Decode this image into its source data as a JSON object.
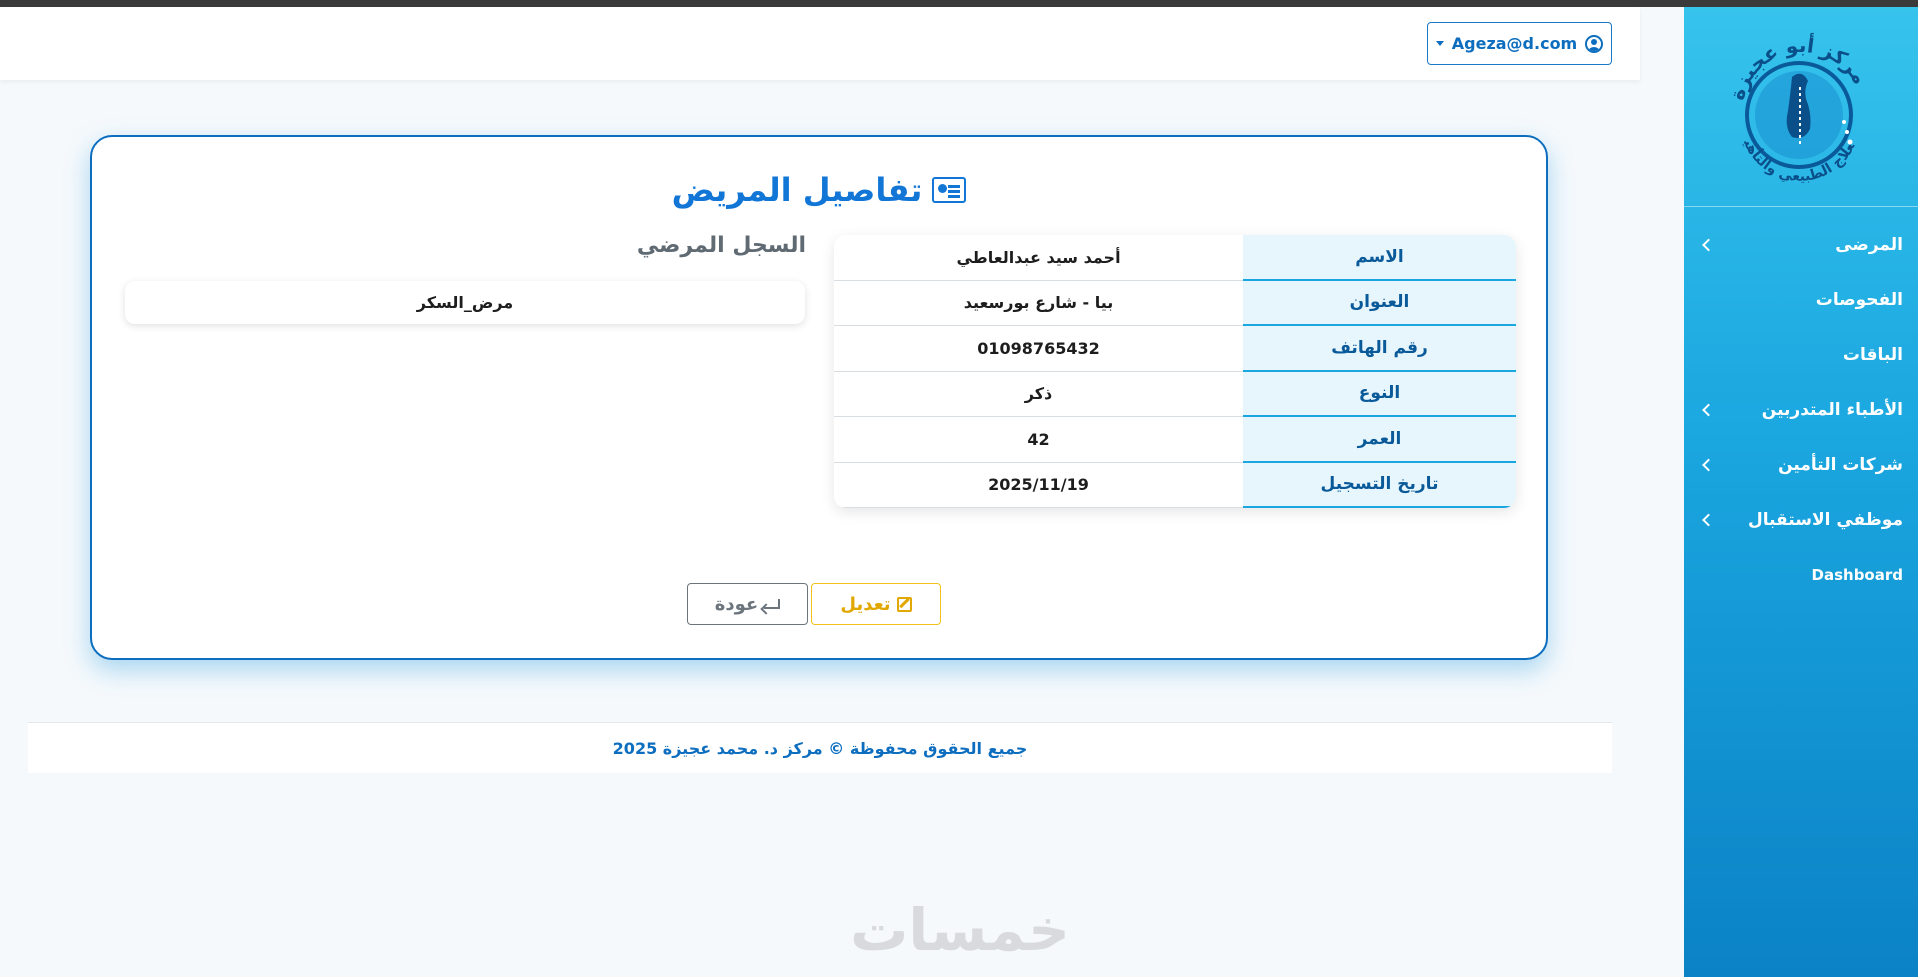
{
  "sidebar": {
    "logo": {
      "text_top": "مركز أبو عجيزة",
      "text_bottom": "للعلاج الطبيعي والتأهيل"
    },
    "items": [
      {
        "label": "المرضى",
        "has_submenu": true
      },
      {
        "label": "الفحوصات",
        "has_submenu": false
      },
      {
        "label": "الباقات",
        "has_submenu": false
      },
      {
        "label": "الأطباء المتدربين",
        "has_submenu": true
      },
      {
        "label": "شركات التأمين",
        "has_submenu": true
      },
      {
        "label": "موظفي الاستقبال",
        "has_submenu": true
      },
      {
        "label": "Dashboard",
        "has_submenu": false
      }
    ]
  },
  "header": {
    "user_email": "Ageza@d.com"
  },
  "card": {
    "title": "تفاصيل المريض",
    "fields": [
      {
        "label": "الاسم",
        "value": "أحمد سيد عبدالعاطي"
      },
      {
        "label": "العنوان",
        "value": "بيا - شارع بورسعيد"
      },
      {
        "label": "رقم الهاتف",
        "value": "01098765432"
      },
      {
        "label": "النوع",
        "value": "ذكر"
      },
      {
        "label": "العمر",
        "value": "42"
      },
      {
        "label": "تاريخ التسجيل",
        "value": "2025/11/19"
      }
    ],
    "record_title": "السجل المرضي",
    "record_value": "مرض_السكر",
    "edit_label": "تعديل",
    "back_label": "عودة"
  },
  "footer": {
    "text": "جميع الحقوق محفوظة © مركز د. محمد عجيزة 2025"
  },
  "watermark": "خمسات",
  "colors": {
    "primary": "#0d6ebf",
    "sidebar_top": "#36c3ec",
    "sidebar_bottom": "#0b82c6",
    "edit": "#e0a800",
    "back": "#6c757d"
  }
}
